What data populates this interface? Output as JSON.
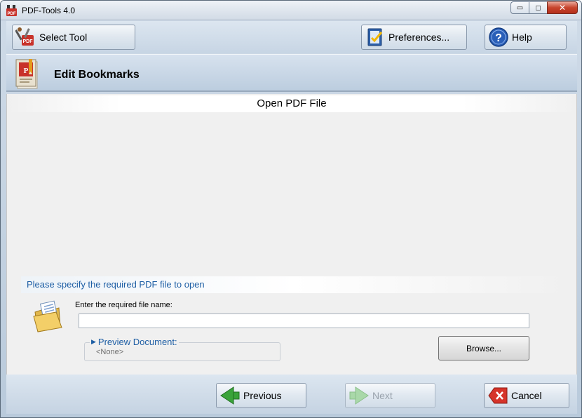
{
  "window": {
    "title": "PDF-Tools 4.0",
    "minimize_glyph": "▭",
    "maximize_glyph": "◻",
    "close_glyph": "✕"
  },
  "toolbar": {
    "select_tool_label": "Select Tool",
    "preferences_label": "Preferences...",
    "help_label": "Help"
  },
  "header": {
    "title": "Edit Bookmarks"
  },
  "content": {
    "section_title": "Open PDF File",
    "instruction": "Please specify the required PDF file to open",
    "file_name_label": "Enter the required file name:",
    "file_name_value": "",
    "browse_label": "Browse...",
    "preview_label": "Preview Document:",
    "preview_value": "<None>"
  },
  "footer": {
    "previous_label": "Previous",
    "next_label": "Next",
    "cancel_label": "Cancel"
  },
  "colors": {
    "accent_blue": "#1f5fa5",
    "previous_arrow": "#3aa33a",
    "next_arrow_disabled": "#a9d8a9",
    "cancel_red": "#d6342a"
  },
  "icons": {
    "app": "pdf-tools-icon",
    "select_tool": "tools-pdf-icon",
    "preferences": "preferences-check-icon",
    "help": "help-question-icon",
    "header": "bookmark-book-icon",
    "file": "open-folder-icon",
    "previous": "arrow-left-icon",
    "next": "arrow-right-icon",
    "cancel": "cancel-x-icon"
  }
}
